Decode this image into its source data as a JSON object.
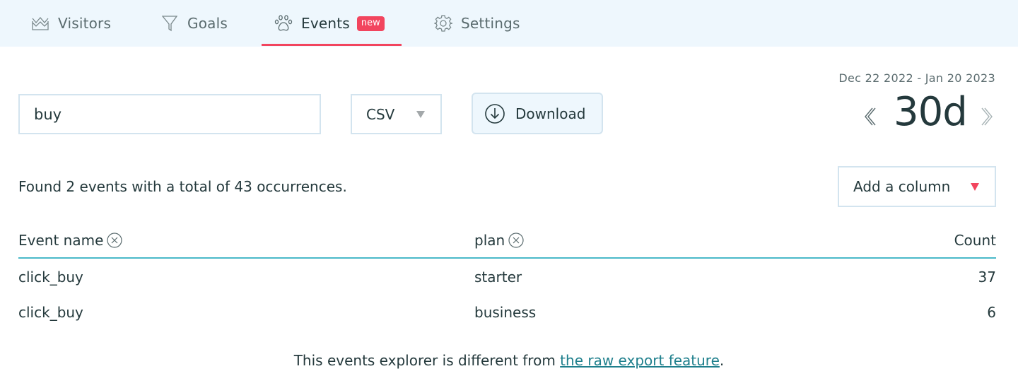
{
  "nav": {
    "tabs": [
      {
        "label": "Visitors",
        "icon": "crown-chart-icon",
        "active": false
      },
      {
        "label": "Goals",
        "icon": "funnel-icon",
        "active": false
      },
      {
        "label": "Events",
        "icon": "paw-icon",
        "active": true,
        "badge": "new"
      },
      {
        "label": "Settings",
        "icon": "gear-icon",
        "active": false
      }
    ],
    "accent_color": "#f2455e"
  },
  "toolbar": {
    "search_value": "buy",
    "format_select": "CSV",
    "download_label": "Download"
  },
  "period": {
    "date_range": "Dec 22 2022 - Jan 20 2023",
    "label": "30d"
  },
  "summary": {
    "text": "Found 2 events with a total of 43 occurrences."
  },
  "add_column": {
    "label": "Add a column"
  },
  "table": {
    "headers": [
      "Event name",
      "plan",
      "Count"
    ],
    "rows": [
      [
        "click_buy",
        "starter",
        "37"
      ],
      [
        "click_buy",
        "business",
        "6"
      ]
    ]
  },
  "footer": {
    "text": "This events explorer is different from ",
    "link": "the raw export feature",
    "suffix": "."
  }
}
